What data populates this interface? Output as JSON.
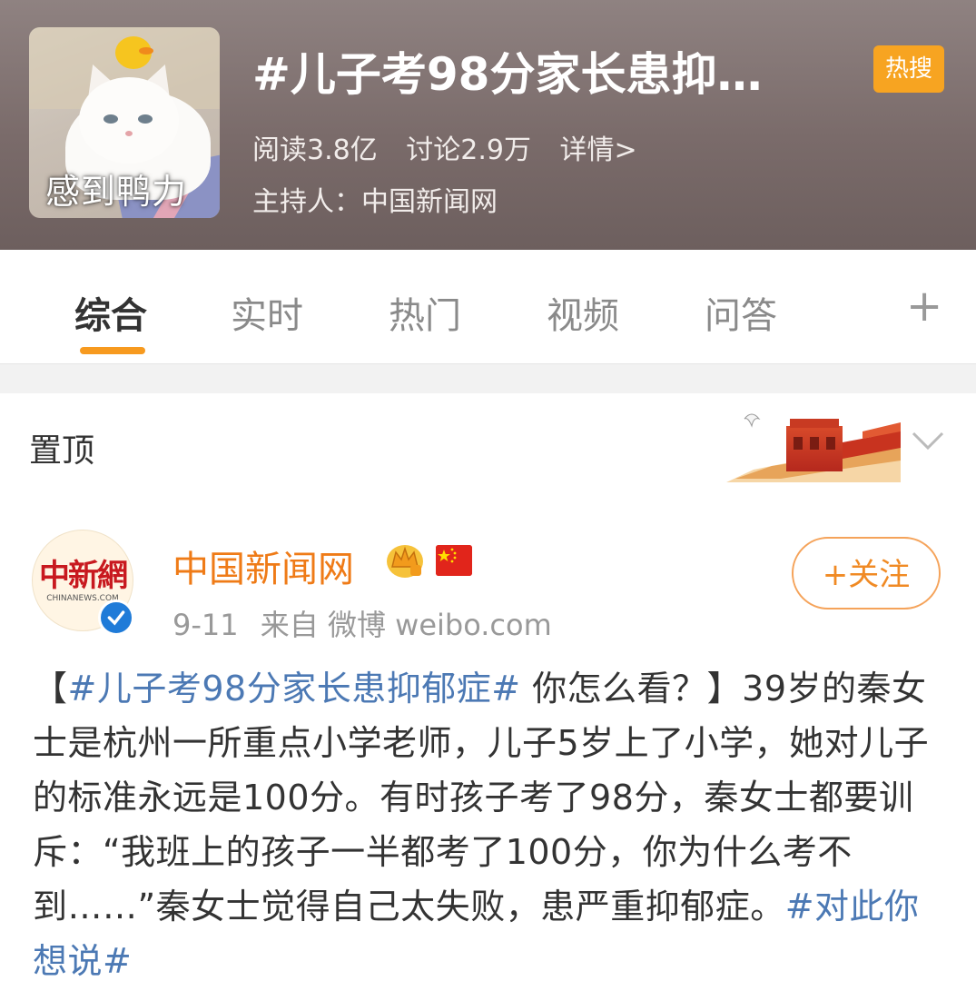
{
  "header": {
    "cover_caption": "感到鸭力",
    "topic_title": "#儿子考98分家长患抑…",
    "badge": "热搜",
    "reads": "阅读3.8亿",
    "discussions": "讨论2.9万",
    "details_link": "详情>",
    "host": "主持人：中国新闻网"
  },
  "tabs": [
    {
      "label": "综合",
      "active": true
    },
    {
      "label": "实时",
      "active": false
    },
    {
      "label": "热门",
      "active": false
    },
    {
      "label": "视频",
      "active": false
    },
    {
      "label": "问答",
      "active": false
    }
  ],
  "tab_plus": "+",
  "pinned": {
    "label": "置顶"
  },
  "post": {
    "avatar_text": "中新網",
    "avatar_sub": "CHINANEWS.COM",
    "author": "中国新闻网",
    "date": "9-11",
    "source": "来自 微博 weibo.com",
    "follow_label": "+关注",
    "text_open": "【",
    "hashtag1": "#儿子考98分家长患抑郁症#",
    "text_mid": " 你怎么看？】39岁的秦女士是杭州一所重点小学老师，儿子5岁上了小学，她对儿子的标准永远是100分。有时孩子考了98分，秦女士都要训斥：“我班上的孩子一半都考了100分，你为什么考不到……”秦女士觉得自己太失败，患严重抑郁症。",
    "hashtag2": "#对此你想说#"
  },
  "colors": {
    "accent": "#f79a1f",
    "author": "#ef7b17",
    "link": "#4c79b4",
    "verified": "#1f7bd8"
  }
}
